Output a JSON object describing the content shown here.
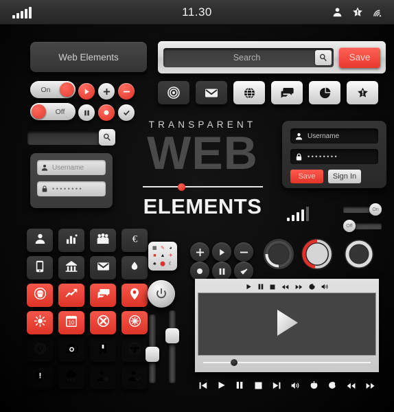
{
  "statusbar": {
    "time": "11.30",
    "signal_bars": [
      5,
      8,
      11,
      14,
      17
    ],
    "right_icons": [
      "user-icon",
      "star-alert-icon",
      "wifi-signal-icon"
    ]
  },
  "header": {
    "title": "Web Elements"
  },
  "toggles": [
    {
      "name": "toggle-on",
      "label": "On",
      "state": "on"
    },
    {
      "name": "toggle-off",
      "label": "Off",
      "state": "off"
    }
  ],
  "round_buttons": [
    {
      "name": "play-button",
      "icon": "play-icon",
      "style": "red"
    },
    {
      "name": "add-button",
      "icon": "plus-icon",
      "style": "light"
    },
    {
      "name": "remove-button",
      "icon": "minus-icon",
      "style": "red"
    },
    {
      "name": "pause-button",
      "icon": "pause-icon",
      "style": "light"
    },
    {
      "name": "record-button",
      "icon": "record-icon",
      "style": "red"
    },
    {
      "name": "confirm-button",
      "icon": "check-icon",
      "style": "light"
    }
  ],
  "search": {
    "placeholder": "Search",
    "magnifier_icon": "search-icon",
    "save_label": "Save"
  },
  "icon_buttons": [
    {
      "name": "target-button",
      "icon": "target-icon",
      "style": "dark"
    },
    {
      "name": "mail-button",
      "icon": "mail-icon",
      "style": "dark"
    },
    {
      "name": "globe-button",
      "icon": "globe-icon",
      "style": "light"
    },
    {
      "name": "chat-button",
      "icon": "chat-icon",
      "style": "light"
    },
    {
      "name": "pie-chart-button",
      "icon": "pie-chart-icon",
      "style": "light"
    },
    {
      "name": "star-badge-button",
      "icon": "star-alert-icon",
      "style": "light"
    }
  ],
  "login_grey": {
    "username_placeholder": "Username",
    "password_value": "••••••••",
    "user_icon": "user-icon",
    "lock_icon": "lock-icon"
  },
  "login_dark": {
    "username_placeholder": "Username",
    "password_value": "••••••••",
    "user_icon": "user-icon",
    "lock_icon": "lock-icon",
    "save_label": "Save",
    "signin_label": "Sign In"
  },
  "hero": {
    "line1": "TRANSPARENT",
    "line2": "WEB",
    "line3": "ELEMENTS",
    "slider_value": 30,
    "slider_knob_color": "#e03228"
  },
  "signal_widget": {
    "bars": [
      5,
      9,
      13,
      17,
      21
    ],
    "toggles": [
      {
        "name": "slider-toggle-on",
        "label": "On",
        "position": "right"
      },
      {
        "name": "slider-toggle-off",
        "label": "Off",
        "position": "left"
      }
    ]
  },
  "icon_grid": [
    {
      "name": "user-icon",
      "style": "dark"
    },
    {
      "name": "bar-chart-icon",
      "style": "dark"
    },
    {
      "name": "group-icon",
      "style": "dark"
    },
    {
      "name": "euro-icon",
      "style": "dark"
    },
    {
      "name": "phone-icon",
      "style": "dark"
    },
    {
      "name": "building-icon",
      "style": "dark"
    },
    {
      "name": "mail-icon",
      "style": "dark"
    },
    {
      "name": "droplet-icon",
      "style": "dark"
    },
    {
      "name": "cupcake-icon",
      "style": "red"
    },
    {
      "name": "trend-line-icon",
      "style": "red"
    },
    {
      "name": "chat-icon",
      "style": "red"
    },
    {
      "name": "location-pin-icon",
      "style": "red"
    },
    {
      "name": "sun-icon",
      "style": "red"
    },
    {
      "name": "calendar-icon",
      "style": "red",
      "label": "10"
    },
    {
      "name": "no-entry-icon",
      "style": "red"
    },
    {
      "name": "gear-icon",
      "style": "red"
    },
    {
      "name": "watch-icon",
      "style": "light"
    },
    {
      "name": "camera-icon",
      "style": "light"
    },
    {
      "name": "bookmark-icon",
      "style": "light"
    },
    {
      "name": "steering-wheel-icon",
      "style": "light"
    },
    {
      "name": "speech-bubble-icon",
      "style": "light"
    },
    {
      "name": "rain-cloud-icon",
      "style": "light"
    },
    {
      "name": "user-delete-icon",
      "style": "light"
    },
    {
      "name": "user-check-icon",
      "style": "light"
    }
  ],
  "palette": {
    "cells": [
      {
        "glyph": "▦",
        "color": "#1a1a1a"
      },
      {
        "glyph": "✎",
        "color": "#e03228"
      },
      {
        "glyph": "◕",
        "color": "#1a1a1a"
      },
      {
        "glyph": "■",
        "color": "#e03228"
      },
      {
        "glyph": "▲",
        "color": "#1a1a1a"
      },
      {
        "glyph": "✈",
        "color": "#e03228"
      },
      {
        "glyph": "♣",
        "color": "#1a1a1a"
      },
      {
        "glyph": "⬤",
        "color": "#e03228"
      },
      {
        "glyph": "☾",
        "color": "#1a1a1a"
      }
    ]
  },
  "power_button": {
    "name": "power-button",
    "icon": "power-icon"
  },
  "dark_circle_buttons": [
    {
      "name": "add-button",
      "icon": "plus-icon"
    },
    {
      "name": "play-button",
      "icon": "play-icon"
    },
    {
      "name": "remove-button",
      "icon": "minus-icon"
    },
    {
      "name": "record-button",
      "icon": "record-icon"
    },
    {
      "name": "pause-button",
      "icon": "pause-icon"
    },
    {
      "name": "confirm-button",
      "icon": "check-icon"
    }
  ],
  "vertical_sliders": [
    {
      "name": "vertical-slider-left",
      "value": 35
    },
    {
      "name": "vertical-slider-right",
      "value": 72
    }
  ],
  "knobs": [
    {
      "name": "progress-knob-dark",
      "arc_percent": 25,
      "arc_color": "#ffffff",
      "face": "dark"
    },
    {
      "name": "progress-knob-red",
      "arc_percent": 42,
      "arc_color": "#e03228",
      "face": "light"
    },
    {
      "name": "progress-knob-ring",
      "arc_percent": 100,
      "arc_color": "#d8d8d8",
      "face": "dark"
    }
  ],
  "player": {
    "top_controls": [
      "play-icon",
      "pause-icon",
      "stop-icon",
      "rewind-icon",
      "fast-forward-icon",
      "loop-icon",
      "volume-icon"
    ],
    "screen_icon": "play-icon",
    "progress_value": 18,
    "bottom_controls": [
      "previous-icon",
      "play-icon",
      "pause-icon",
      "stop-icon",
      "next-icon",
      "volume-icon",
      "refresh-ccw-icon",
      "refresh-cw-icon",
      "rewind-icon",
      "fast-forward-icon"
    ]
  }
}
